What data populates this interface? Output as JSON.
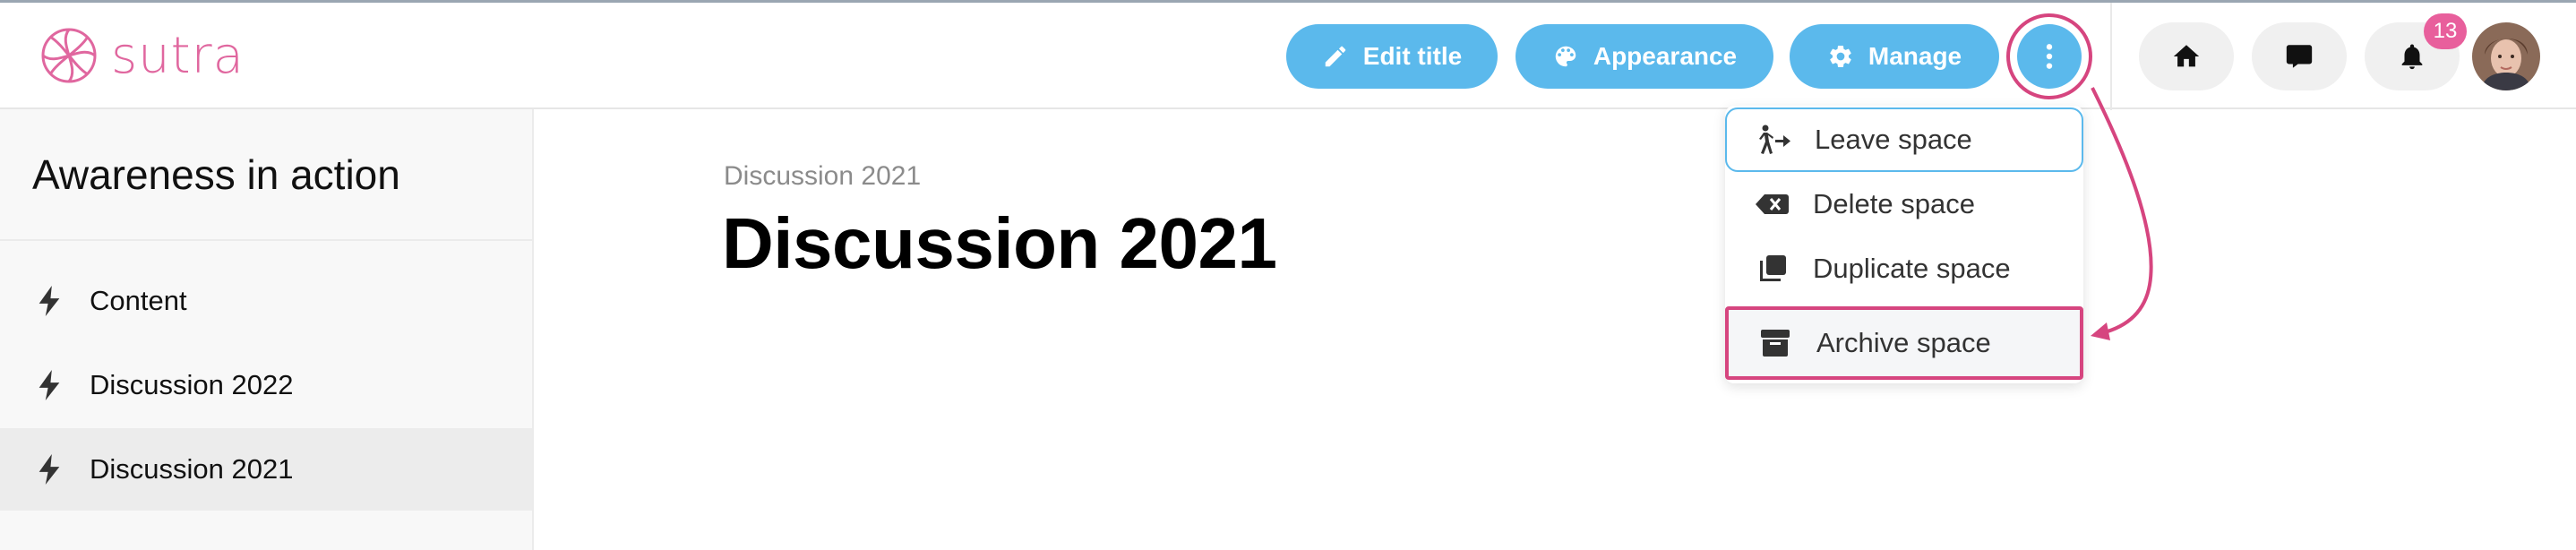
{
  "brand": {
    "name": "sutra",
    "color": "#e0679f",
    "icon": "sutra-logo-icon"
  },
  "header": {
    "buttons": [
      {
        "label": "Edit title",
        "icon": "edit-icon"
      },
      {
        "label": "Appearance",
        "icon": "palette-icon"
      },
      {
        "label": "Manage",
        "icon": "gear-icon"
      }
    ],
    "more_icon": "more-vertical-icon",
    "nav": [
      {
        "name": "home",
        "icon": "home-icon"
      },
      {
        "name": "messages",
        "icon": "chat-icon"
      },
      {
        "name": "notifications",
        "icon": "bell-icon"
      }
    ],
    "notification_count": "13",
    "accent": "#5bb9ec",
    "highlight": "#d6457f"
  },
  "sidebar": {
    "title": "Awareness in action",
    "items": [
      {
        "label": "Content",
        "icon": "bolt-icon",
        "active": false
      },
      {
        "label": "Discussion 2022",
        "icon": "bolt-icon",
        "active": false
      },
      {
        "label": "Discussion 2021",
        "icon": "bolt-icon",
        "active": true
      }
    ]
  },
  "main": {
    "breadcrumb": "Discussion 2021",
    "title": "Discussion 2021"
  },
  "menu": {
    "items": [
      {
        "label": "Leave space",
        "icon": "leave-icon"
      },
      {
        "label": "Delete space",
        "icon": "backspace-icon"
      },
      {
        "label": "Duplicate space",
        "icon": "duplicate-icon"
      },
      {
        "label": "Archive space",
        "icon": "archive-icon"
      }
    ]
  }
}
